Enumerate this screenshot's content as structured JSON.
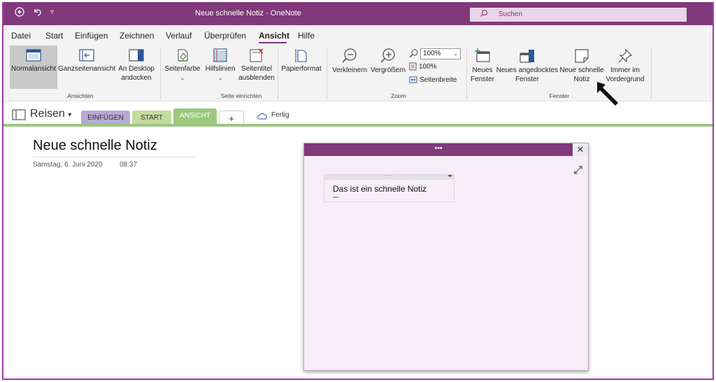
{
  "window": {
    "title": "Neue schnelle Notiz  -  OneNote",
    "search_placeholder": "Suchen"
  },
  "menu": {
    "tabs": [
      "Datei",
      "Start",
      "Einfügen",
      "Zeichnen",
      "Verlauf",
      "Überprüfen",
      "Ansicht",
      "Hilfe"
    ],
    "active": "Ansicht"
  },
  "ribbon": {
    "ansichten": {
      "label": "Ansichten",
      "normal": "Normalansicht",
      "fullpage": "Ganzseitenansicht",
      "dock_l1": "An Desktop",
      "dock_l2": "andocken"
    },
    "seite": {
      "label": "Seite einrichten",
      "color": "Seitenfarbe",
      "lines": "Hilfslinien",
      "hide_l1": "Seitentitel",
      "hide_l2": "ausblenden",
      "paper": "Papierformat"
    },
    "zoom": {
      "label": "Zoom",
      "out": "Verkleinern",
      "in": "Vergrößern",
      "value": "100%",
      "hundred": "100%",
      "width": "Seitenbreite"
    },
    "fenster": {
      "label": "Fenster",
      "new_l1": "Neues",
      "new_l2": "Fenster",
      "docked_l1": "Neues angedocktes",
      "docked_l2": "Fenster",
      "quick_l1": "Neue schnelle",
      "quick_l2": "Notiz",
      "top_l1": "Immer im",
      "top_l2": "Vordergrund"
    }
  },
  "notebook": {
    "name": "Reisen",
    "sections": [
      "EINFÜGEN",
      "START",
      "ANSICHT",
      "+"
    ],
    "active_section": "ANSICHT",
    "done": "Fertig"
  },
  "page": {
    "title": "Neue schnelle Notiz",
    "date": "Samstag, 6. Juni 2020",
    "time": "08:37"
  },
  "quick_note": {
    "grip": "•••",
    "close": "✕",
    "text": "Das ist ein schnelle Notiz"
  },
  "colors": {
    "accent": "#80397b",
    "ribbon_bg": "#f3f3f3",
    "section_green": "#9bc77e",
    "section_purple": "#b9a8d6"
  }
}
